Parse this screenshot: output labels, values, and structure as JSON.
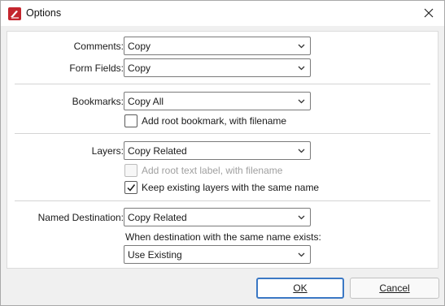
{
  "window": {
    "title": "Options"
  },
  "icons": {
    "app": "pdf-app-icon",
    "close": "close-icon",
    "dropdown": "chevron-down-icon",
    "check": "checkmark-icon"
  },
  "colors": {
    "app_icon": "#c4262e",
    "accent": "#3b78c4"
  },
  "comments": {
    "label": "Comments:",
    "value": "Copy"
  },
  "form_fields": {
    "label": "Form Fields:",
    "value": "Copy"
  },
  "bookmarks": {
    "label": "Bookmarks:",
    "value": "Copy All",
    "add_root": {
      "label": "Add root bookmark, with filename",
      "checked": false
    }
  },
  "layers": {
    "label": "Layers:",
    "value": "Copy Related",
    "add_root_text": {
      "label": "Add root text label, with filename",
      "checked": false,
      "enabled": false
    },
    "keep_existing": {
      "label": "Keep existing layers with the same name",
      "checked": true
    }
  },
  "named_destination": {
    "label": "Named Destination:",
    "value": "Copy Related",
    "conflict_label": "When destination with the same name exists:",
    "conflict_value": "Use Existing"
  },
  "buttons": {
    "ok": "OK",
    "cancel": "Cancel"
  }
}
